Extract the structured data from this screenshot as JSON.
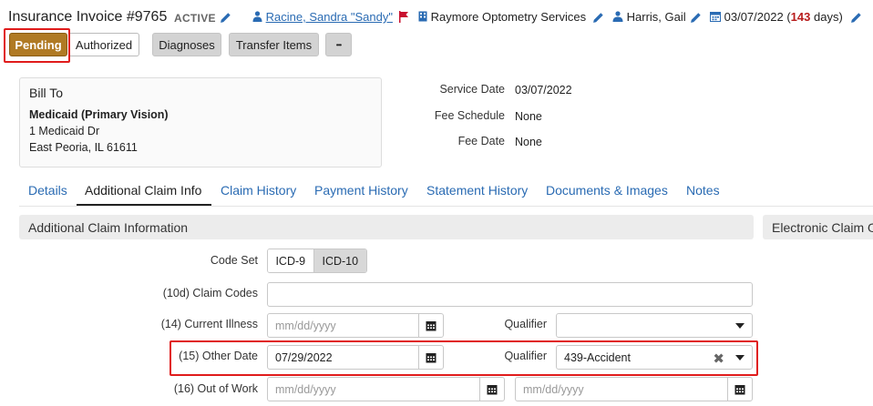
{
  "header": {
    "title": "Insurance Invoice #9765",
    "status": "ACTIVE",
    "patient": "Racine, Sandra \"Sandy\"",
    "practice": "Raymore Optometry Services",
    "provider": "Harris, Gail",
    "date": "03/07/2022",
    "days_open": "(",
    "days_count": "143",
    "days_suffix": " days)"
  },
  "toolbar": {
    "pending": "Pending",
    "authorized": "Authorized",
    "diagnoses": "Diagnoses",
    "transfer": "Transfer Items",
    "more": "•••"
  },
  "bill_to": {
    "title": "Bill To",
    "payer": "Medicaid (Primary Vision)",
    "address1": "1 Medicaid Dr",
    "address2": "East Peoria, IL 61611"
  },
  "summary": {
    "service_date_label": "Service Date",
    "service_date": "03/07/2022",
    "fee_schedule_label": "Fee Schedule",
    "fee_schedule": "None",
    "fee_date_label": "Fee Date",
    "fee_date": "None"
  },
  "tabs": [
    "Details",
    "Additional Claim Info",
    "Claim History",
    "Payment History",
    "Statement History",
    "Documents & Images",
    "Notes"
  ],
  "sections": {
    "additional": "Additional Claim Information",
    "electronic": "Electronic Claim Options"
  },
  "form": {
    "code_set_label": "Code Set",
    "icd9": "ICD-9",
    "icd10": "ICD-10",
    "claim_codes_label": "(10d) Claim Codes",
    "claim_codes_value": "",
    "current_illness_label": "(14) Current Illness",
    "current_illness_placeholder": "mm/dd/yyyy",
    "qualifier_label": "Qualifier",
    "qualifier_14_value": "",
    "other_date_label": "(15) Other Date",
    "other_date_value": "07/29/2022",
    "qualifier_15_value": "439-Accident",
    "out_of_work_label": "(16) Out of Work",
    "out_of_work_from_placeholder": "mm/dd/yyyy",
    "out_of_work_to_placeholder": "mm/dd/yyyy"
  },
  "colors": {
    "pending_bg": "#b07a24",
    "link": "#2a6bb3",
    "highlight": "#e01b1b",
    "flag": "#c8102e"
  }
}
